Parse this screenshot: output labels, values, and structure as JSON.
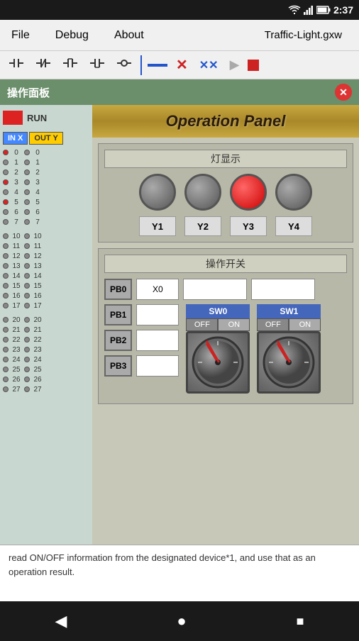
{
  "statusBar": {
    "time": "2:37",
    "wifiIcon": "wifi",
    "signalIcon": "signal",
    "batteryIcon": "battery"
  },
  "menuBar": {
    "file": "File",
    "debug": "Debug",
    "about": "About",
    "title": "Traffic-Light.gxw"
  },
  "toolbar": {
    "icons": [
      "ladder-contact-no",
      "ladder-contact-nc",
      "ladder-contact-p",
      "ladder-contact-n",
      "ladder-coil",
      "divider",
      "line",
      "delete-x",
      "cross-x2",
      "play",
      "stop"
    ]
  },
  "window": {
    "title": "操作面板",
    "closeBtn": "✕"
  },
  "leftPanel": {
    "runLabel": "RUN",
    "inLabel": "IN X",
    "outLabel": "OUT Y",
    "inputs": [
      {
        "num": "0",
        "active": true
      },
      {
        "num": "1",
        "active": false
      },
      {
        "num": "2",
        "active": false
      },
      {
        "num": "3",
        "active": true
      },
      {
        "num": "4",
        "active": false
      },
      {
        "num": "5",
        "active": true
      },
      {
        "num": "6",
        "active": false
      },
      {
        "num": "7",
        "active": false
      },
      {
        "num": "10",
        "active": false
      },
      {
        "num": "11",
        "active": false
      },
      {
        "num": "12",
        "active": false
      },
      {
        "num": "13",
        "active": false
      },
      {
        "num": "14",
        "active": false
      },
      {
        "num": "15",
        "active": false
      },
      {
        "num": "16",
        "active": false
      },
      {
        "num": "17",
        "active": false
      },
      {
        "num": "20",
        "active": false
      },
      {
        "num": "21",
        "active": false
      },
      {
        "num": "22",
        "active": false
      },
      {
        "num": "23",
        "active": false
      },
      {
        "num": "24",
        "active": false
      },
      {
        "num": "25",
        "active": false
      },
      {
        "num": "26",
        "active": false
      },
      {
        "num": "27",
        "active": false
      }
    ],
    "outputs": [
      {
        "num": "0",
        "active": false
      },
      {
        "num": "1",
        "active": false
      },
      {
        "num": "2",
        "active": false
      },
      {
        "num": "3",
        "active": false
      },
      {
        "num": "4",
        "active": false
      },
      {
        "num": "5",
        "active": false
      },
      {
        "num": "6",
        "active": false
      },
      {
        "num": "7",
        "active": false
      },
      {
        "num": "10",
        "active": false
      },
      {
        "num": "11",
        "active": false
      },
      {
        "num": "12",
        "active": false
      },
      {
        "num": "13",
        "active": false
      },
      {
        "num": "14",
        "active": false
      },
      {
        "num": "15",
        "active": false
      },
      {
        "num": "16",
        "active": false
      },
      {
        "num": "17",
        "active": false
      },
      {
        "num": "20",
        "active": false
      },
      {
        "num": "21",
        "active": false
      },
      {
        "num": "22",
        "active": false
      },
      {
        "num": "23",
        "active": false
      },
      {
        "num": "24",
        "active": false
      },
      {
        "num": "25",
        "active": false
      },
      {
        "num": "26",
        "active": false
      },
      {
        "num": "27",
        "active": false
      }
    ]
  },
  "operationPanel": {
    "title": "Operation Panel",
    "lampSection": {
      "title": "灯显示",
      "lamps": [
        {
          "id": "Y1",
          "active": false
        },
        {
          "id": "Y2",
          "active": false
        },
        {
          "id": "Y3",
          "active": true
        },
        {
          "id": "Y4",
          "active": false
        }
      ]
    },
    "switchSection": {
      "title": "操作开关",
      "buttons": [
        "PB0",
        "PB1",
        "PB2",
        "PB3"
      ],
      "inputX0": "X0",
      "sw0Label": "SW0",
      "sw1Label": "SW1",
      "offLabel": "OFF",
      "onLabel": "ON"
    }
  },
  "textArea": {
    "text": "read ON/OFF information from the designated device*1, and use that as an operation result."
  },
  "navBar": {
    "backIcon": "◀",
    "homeIcon": "●",
    "squareIcon": "■"
  }
}
